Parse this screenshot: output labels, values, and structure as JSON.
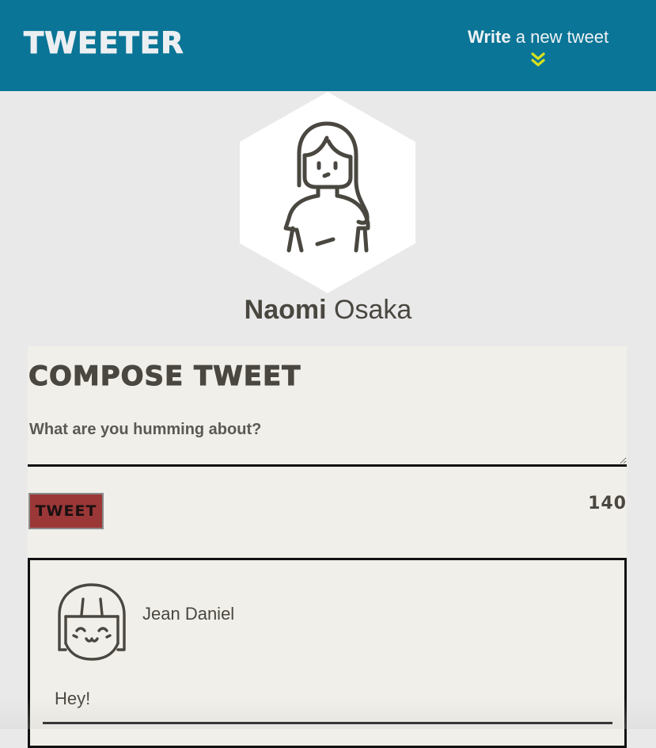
{
  "nav": {
    "brand": "TWEETER",
    "write_bold": "Write",
    "write_rest": "a new tweet"
  },
  "profile": {
    "first_name": "Naomi",
    "last_name": "Osaka"
  },
  "compose": {
    "title": "COMPOSE TWEET",
    "placeholder": "What are you humming about?",
    "button_label": "TWEET",
    "counter": "140"
  },
  "tweets": [
    {
      "author": "Jean Daniel",
      "text": "Hey!"
    }
  ],
  "colors": {
    "nav_bg": "#0a7596",
    "accent_chevron": "#d7e11f",
    "button_bg": "#9b3737",
    "panel_bg": "#f1efe9",
    "page_bg": "#e9e9ea"
  },
  "icons": {
    "chevron": "double-chevron-down-icon",
    "profile_avatar": "woman-avatar-icon",
    "tweet_avatar": "girl-avatar-icon"
  }
}
